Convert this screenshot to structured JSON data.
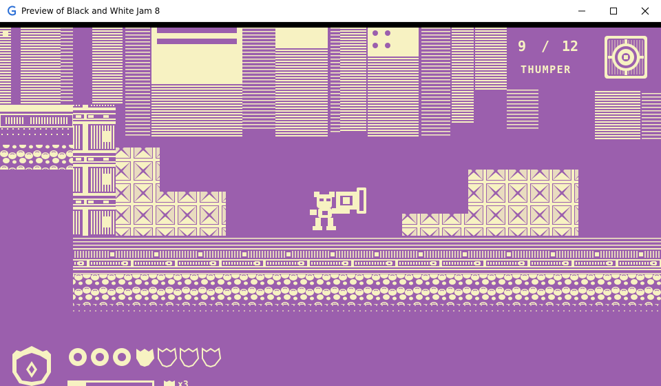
{
  "window": {
    "title": "Preview of Black and White Jam 8",
    "buttons": {
      "minimize": "minimize",
      "maximize": "maximize",
      "close": "close"
    }
  },
  "colors": {
    "background": "#9b5fad",
    "foreground": "#f7f2c2",
    "ink": "#7a3f8e"
  },
  "hud": {
    "ammo_current": "9",
    "ammo_separator": "/",
    "ammo_max": "12",
    "weapon_name": "THUMPER",
    "weapon_icon": "target-icon",
    "player_badge_icon": "shield-badge-icon",
    "health_full": 3,
    "health_total": 7,
    "lives_label": "x3",
    "power_level": 0.2
  },
  "scene": {
    "player": "robot-player-with-blaster",
    "terrain": [
      "crate-stack-left",
      "metal-floor",
      "rock-rubble",
      "crate-stack-right"
    ]
  }
}
